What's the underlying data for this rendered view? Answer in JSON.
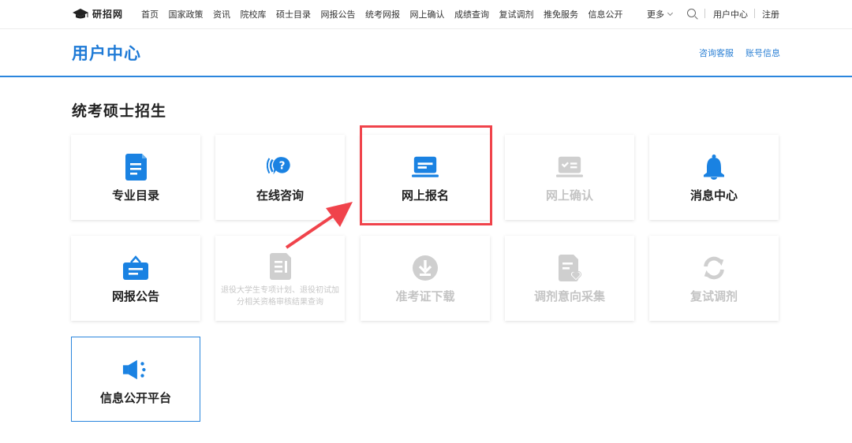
{
  "nav": {
    "logo_text": "研招网",
    "items": [
      "首页",
      "国家政策",
      "资讯",
      "院校库",
      "硕士目录",
      "网报公告",
      "统考网报",
      "网上确认",
      "成绩查询",
      "复试调剂",
      "推免服务",
      "信息公开"
    ],
    "more": "更多",
    "user_center": "用户中心",
    "register": "注册"
  },
  "header": {
    "title": "用户中心",
    "consult_link": "咨询客服",
    "account_link": "账号信息"
  },
  "section": {
    "title": "统考硕士招生"
  },
  "cards": {
    "major_catalog": "专业目录",
    "online_consult": "在线咨询",
    "online_registration": "网上报名",
    "online_confirm": "网上确认",
    "message_center": "消息中心",
    "registration_notice": "网报公告",
    "veteran_query": "退役大学生专项计划、退役初试加分相关资格审核结果查询",
    "admission_ticket": "准考证下载",
    "adjustment_collect": "调剂意向采集",
    "retest_adjust": "复试调剂",
    "info_platform": "信息公开平台"
  },
  "colors": {
    "primary": "#2b86dd",
    "icon_blue": "#1a82e2",
    "disabled_gray": "#cfcfcf",
    "highlight_red": "#f0434b"
  }
}
